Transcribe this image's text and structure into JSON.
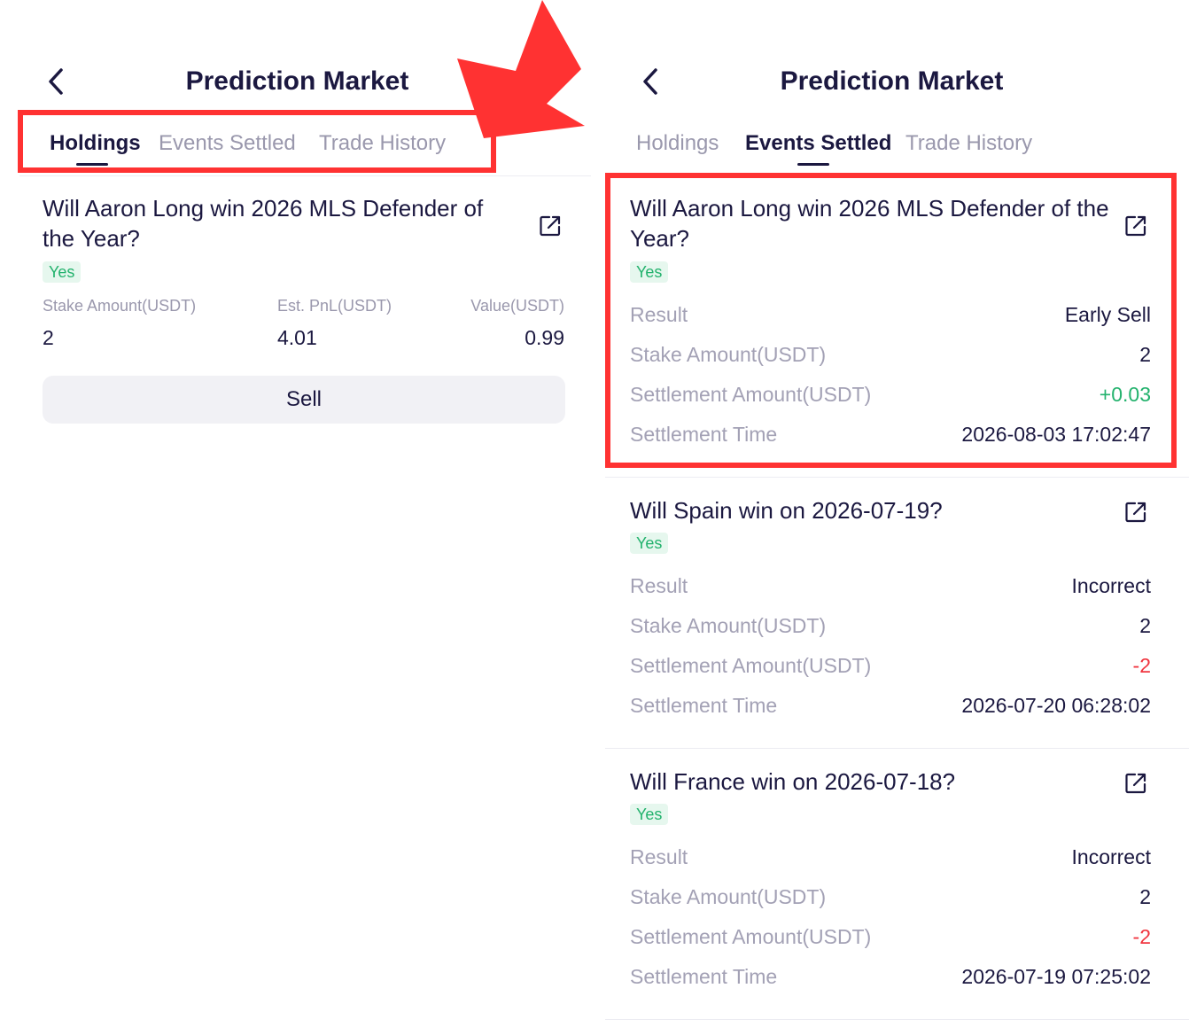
{
  "app": {
    "title": "Prediction Market",
    "tabs": [
      "Holdings",
      "Events Settled",
      "Trade History"
    ]
  },
  "holdings_view": {
    "active_tab": "Holdings",
    "position": {
      "question": "Will Aaron Long win 2026 MLS Defender of the Year?",
      "outcome": "Yes",
      "stake_label": "Stake Amount(USDT)",
      "stake_value": "2",
      "pnl_label": "Est. PnL(USDT)",
      "pnl_value": "4.01",
      "value_label": "Value(USDT)",
      "value_value": "0.99",
      "sell_label": "Sell"
    }
  },
  "settled_view": {
    "active_tab": "Events Settled",
    "row_labels": {
      "result": "Result",
      "stake": "Stake Amount(USDT)",
      "settlement": "Settlement Amount(USDT)",
      "time": "Settlement Time"
    },
    "events": [
      {
        "question": "Will Aaron Long win 2026 MLS Defender of the Year?",
        "outcome": "Yes",
        "result": "Early Sell",
        "stake": "2",
        "settlement": "+0.03",
        "settlement_color": "#23b26d",
        "time": "2026-08-03 17:02:47"
      },
      {
        "question": "Will Spain win on 2026-07-19?",
        "outcome": "Yes",
        "result": "Incorrect",
        "stake": "2",
        "settlement": "-2",
        "settlement_color": "#f0353f",
        "time": "2026-07-20 06:28:02"
      },
      {
        "question": "Will France win on 2026-07-18?",
        "outcome": "Yes",
        "result": "Incorrect",
        "stake": "2",
        "settlement": "-2",
        "settlement_color": "#f0353f",
        "time": "2026-07-19 07:25:02"
      }
    ]
  },
  "colors": {
    "primary_text": "#1b1840",
    "muted_text": "#9a98ad",
    "positive": "#23b26d",
    "negative": "#f0353f",
    "annotation": "#ff3232"
  }
}
